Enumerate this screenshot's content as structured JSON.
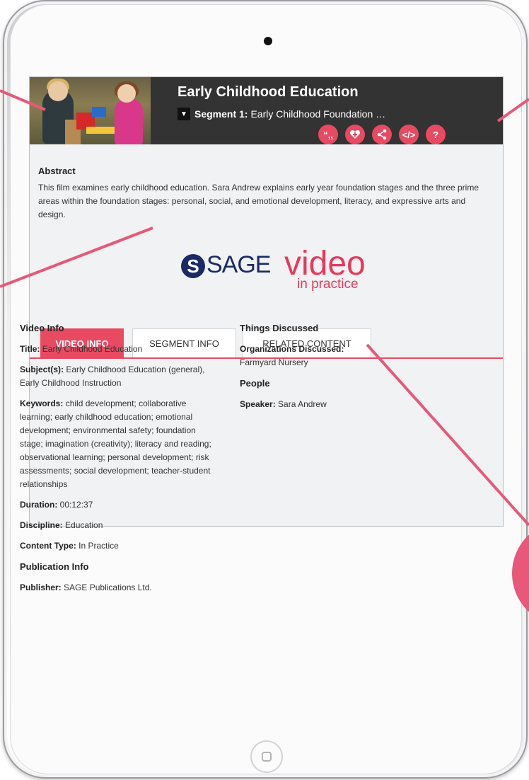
{
  "header": {
    "title": "Early Childhood Education",
    "segment_label": "Segment 1:",
    "segment_name": "Early Childhood Foundation …"
  },
  "actions": [
    {
      "name": "cite-button",
      "glyph": "“,,",
      "icon": "quote-icon"
    },
    {
      "name": "favorite-button",
      "icon": "heart-plus-icon"
    },
    {
      "name": "share-button",
      "icon": "share-icon"
    },
    {
      "name": "embed-button",
      "glyph": "</>",
      "icon": "code-icon"
    },
    {
      "name": "help-button",
      "glyph": "?",
      "icon": "question-icon"
    }
  ],
  "abstract": {
    "title": "Abstract",
    "text": "This film examines early childhood education. Sara Andrew explains early year foundation stages and the three prime areas within the foundation stages: personal, social, and emotional development, literacy, and expressive arts and design."
  },
  "logo": {
    "brand": "SAGE",
    "product": "video",
    "tagline": "in practice"
  },
  "tabs": [
    {
      "label": "VIDEO INFO",
      "active": true
    },
    {
      "label": "SEGMENT INFO",
      "active": false
    },
    {
      "label": "RELATED CONTENT",
      "active": false
    }
  ],
  "video_info": {
    "section_title": "Video Info",
    "title_label": "Title:",
    "title_value": "Early Childhood Education",
    "subjects_label": "Subject(s):",
    "subjects_value": "Early Childhood Education (general), Early Childhood Instruction",
    "keywords_label": "Keywords:",
    "keywords_value": "child development; collaborative learning; early childhood education; emotional development; environmental safety; foundation stage; imagination (creativity); literacy and reading; observational learning; personal development; risk assessments; social development; teacher-student relationships",
    "duration_label": "Duration:",
    "duration_value": "00:12:37",
    "discipline_label": "Discipline:",
    "discipline_value": "Education",
    "content_type_label": "Content Type:",
    "content_type_value": "In Practice",
    "publication_title": "Publication Info",
    "publisher_label": "Publisher:",
    "publisher_value": "SAGE Publications Ltd."
  },
  "things_discussed": {
    "section_title": "Things Discussed",
    "orgs_label": "Organizations Discussed:",
    "orgs_value": "Farmyard Nursery",
    "people_title": "People",
    "speaker_label": "Speaker:",
    "speaker_value": "Sara Andrew"
  },
  "colors": {
    "accent": "#e84a62",
    "header_bg": "#333333",
    "brand_navy": "#1b2a66"
  }
}
